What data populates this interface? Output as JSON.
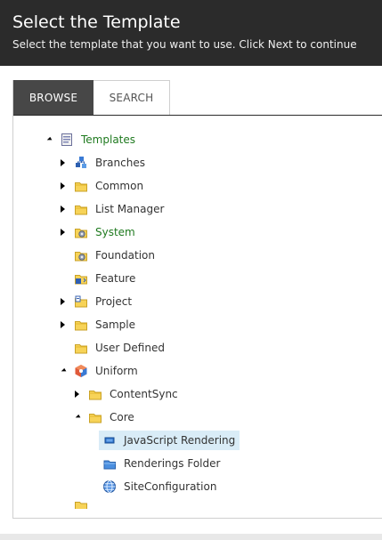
{
  "header": {
    "title": "Select the Template",
    "subtitle": "Select the template that you want to use. Click Next to continue"
  },
  "tabs": [
    {
      "label": "BROWSE",
      "active": true
    },
    {
      "label": "SEARCH",
      "active": false
    }
  ],
  "tree": {
    "root": {
      "label": "Templates",
      "icon": "templates-icon",
      "expanded": true
    },
    "items": [
      {
        "label": "Branches",
        "icon": "branches-icon",
        "expanded": false
      },
      {
        "label": "Common",
        "icon": "folder-icon",
        "expanded": false
      },
      {
        "label": "List Manager",
        "icon": "folder-icon",
        "expanded": false
      },
      {
        "label": "System",
        "icon": "system-folder-icon",
        "expanded": false
      },
      {
        "label": "Foundation",
        "icon": "system-folder-icon"
      },
      {
        "label": "Feature",
        "icon": "feature-folder-icon"
      },
      {
        "label": "Project",
        "icon": "project-folder-icon",
        "expanded": false
      },
      {
        "label": "Sample",
        "icon": "folder-icon",
        "expanded": false
      },
      {
        "label": "User Defined",
        "icon": "folder-icon"
      },
      {
        "label": "Uniform",
        "icon": "uniform-icon",
        "expanded": true
      }
    ],
    "uniform_children": [
      {
        "label": "ContentSync",
        "icon": "folder-icon",
        "expanded": false
      },
      {
        "label": "Core",
        "icon": "folder-icon",
        "expanded": true
      }
    ],
    "core_children": [
      {
        "label": "JavaScript Rendering",
        "icon": "rendering-icon",
        "selected": true
      },
      {
        "label": "Renderings Folder",
        "icon": "renderings-folder-icon"
      },
      {
        "label": "SiteConfiguration",
        "icon": "globe-icon"
      }
    ]
  }
}
